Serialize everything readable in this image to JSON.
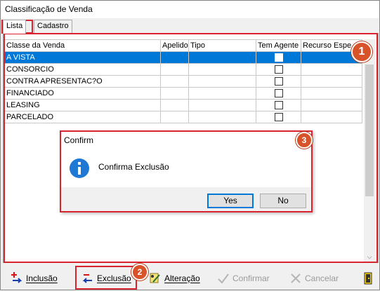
{
  "window": {
    "title": "Classificação de Venda"
  },
  "tabs": [
    {
      "label": "Lista",
      "active": true
    },
    {
      "label": "Cadastro",
      "active": false
    }
  ],
  "grid": {
    "columns": [
      "Classe da Venda",
      "Apelido",
      "Tipo",
      "Tem Agente",
      "Recurso Espe"
    ],
    "rows": [
      {
        "classe": "A VISTA",
        "apelido": "",
        "tipo": "",
        "tem_agente": false,
        "recurso": "",
        "selected": true
      },
      {
        "classe": "CONSORCIO",
        "apelido": "",
        "tipo": "",
        "tem_agente": false,
        "recurso": ""
      },
      {
        "classe": "CONTRA APRESENTAC?O",
        "apelido": "",
        "tipo": "",
        "tem_agente": false,
        "recurso": ""
      },
      {
        "classe": "FINANCIADO",
        "apelido": "",
        "tipo": "",
        "tem_agente": false,
        "recurso": ""
      },
      {
        "classe": "LEASING",
        "apelido": "",
        "tipo": "",
        "tem_agente": false,
        "recurso": ""
      },
      {
        "classe": "PARCELADO",
        "apelido": "",
        "tipo": "",
        "tem_agente": false,
        "recurso": ""
      }
    ]
  },
  "dialog": {
    "title": "Confirm",
    "message": "Confirma Exclusão",
    "icon": "info-icon",
    "yes_label": "Yes",
    "no_label": "No"
  },
  "toolbar": {
    "inclusao": "Inclusão",
    "exclusao": "Exclusão",
    "alteracao": "Alteração",
    "confirmar": "Confirmar",
    "cancelar": "Cancelar"
  },
  "annotations": {
    "badge1": "1",
    "badge2": "2",
    "badge3": "3",
    "color": "#d9232e"
  }
}
